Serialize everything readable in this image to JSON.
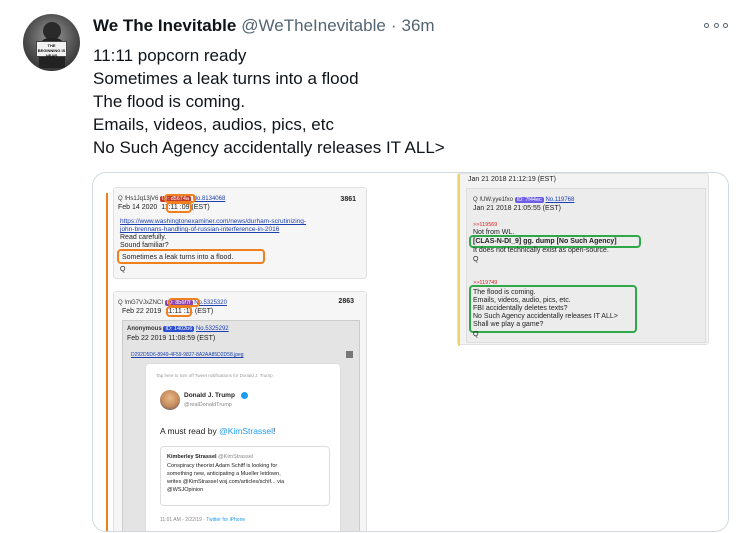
{
  "tweet": {
    "display_name": "We The Inevitable",
    "handle": "@WeTheInevitable",
    "separator": "·",
    "time": "36m",
    "avatar_sign": "THE BEGINNING IS NEAR",
    "lines": [
      "11:11 popcorn ready",
      "Sometimes a leak turns into a flood",
      "The flood is coming.",
      "Emails, videos, audios, pics, etc",
      "No Such Agency accidentally releases IT ALL>"
    ]
  },
  "colors": {
    "orange": "#f07f1d",
    "green": "#2fa84a",
    "link": "#1a3fb0",
    "twitter_blue": "#1d9bf0"
  },
  "image": {
    "post1": {
      "meta": "Q !Hs1Jq13jV6",
      "id": "ID: d5674a",
      "no": "No.8134068",
      "date": "Feb 14 2020",
      "time_box": "11:11",
      "time_rest": ":09 (EST)",
      "number": "3861",
      "link1": "https://www.washingtonexaminer.com/news/durham-scrutinizing-",
      "link2": "john-brennans-handling-of-russian-interference-in-2016",
      "line1": "Read carefully.",
      "line2": "Sound familiar?",
      "highlight": "Sometimes a leak turns into a flood.",
      "sig": "Q"
    },
    "post2": {
      "meta": "Q !mG7VJxZNCI",
      "id": "ID: 8b6f7f",
      "no": "No.5325320",
      "date": "Feb 22 2019",
      "time_box": "11:11",
      "time_rest": ":11 (EST)",
      "number": "2863",
      "anon_name": "Anonymous",
      "anon_id": "ID: 1402b6",
      "anon_no": "No.5325292",
      "anon_date": "Feb 22 2019 11:08:59 (EST)",
      "file": "D292D5D6-8949-4F59-9827-8A2AA85D2D58.jpeg",
      "embed": {
        "notify": "Tap here to turn off Tweet notifications for Donald J. Trump",
        "name": "Donald J. Trump",
        "handle": "@realDonaldTrump",
        "text_prefix": "A must read by ",
        "mention": "@KimStrassel",
        "text_suffix": "!",
        "quote_name": "Kimberley Strassel",
        "quote_handle": "@KimStrassel",
        "quote_text": [
          "Conspiracy theorist Adam Schiff is looking for",
          "something new, anticipating a Mueller letdown,",
          "writes @KimStrassel wsj.com/articles/schif... via",
          "@WSJOpinion"
        ],
        "footer_time": "11:01 AM - 2/22/19 · ",
        "footer_app": "Twitter for iPhone"
      }
    },
    "post3": {
      "header_date": "Jan 21 2018 21:12:19 (EST)",
      "meta": "Q !UW.yye1fxo",
      "id": "ID: 7f44ec",
      "no": "No.119768",
      "date": "Jan 21 2018 21:05:55 (EST)",
      "reply": ">>119569",
      "line1": "Not from WL.",
      "highlight": "[CLAS-N-DI_9] gg. dump [No Such Agency]",
      "line2": "It does not technically exist as open-source.",
      "sig": "Q",
      "reply2": ">>119749",
      "box_lines": [
        "The flood is coming.",
        "Emails, videos, audio, pics, etc.",
        "FBI accidentally deletes texts?",
        "No Such Agency accidentally releases IT ALL>",
        "Shall we play a game?"
      ],
      "sig2": "Q"
    }
  }
}
